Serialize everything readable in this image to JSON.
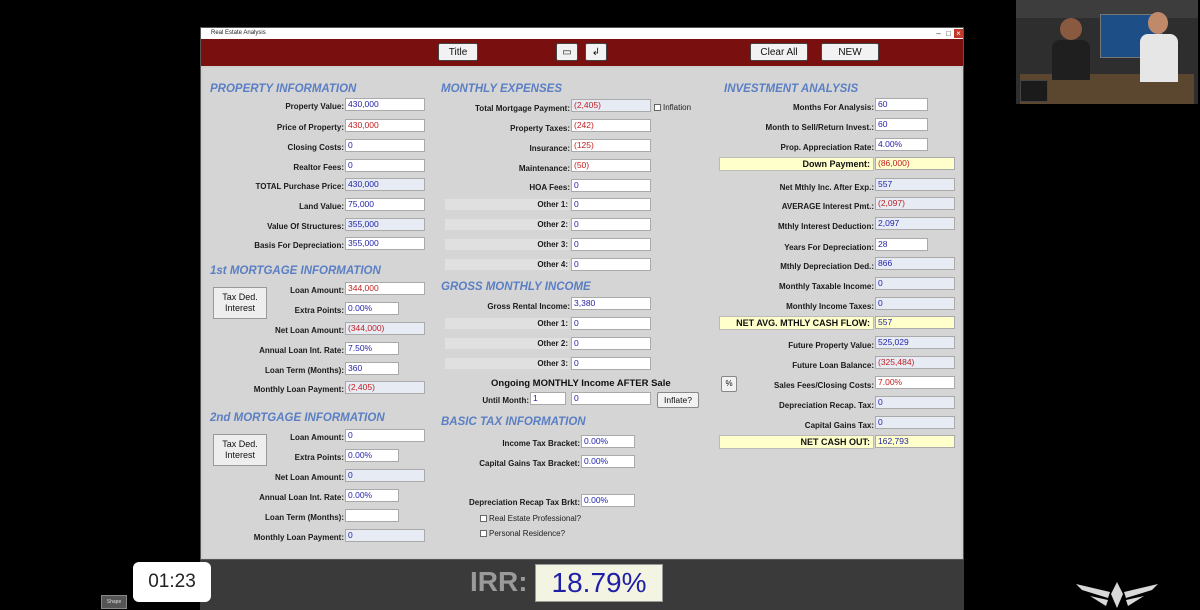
{
  "window": {
    "title": "Real Estate Analysis"
  },
  "toolbar": {
    "title_label": "Title",
    "clear_label": "Clear All",
    "new_label": "NEW"
  },
  "property": {
    "heading": "PROPERTY INFORMATION",
    "value_label": "Property Value:",
    "value": "430,000",
    "price_label": "Price of Property:",
    "price": "430,000",
    "closing_label": "Closing Costs:",
    "closing": "0",
    "realtor_label": "Realtor Fees:",
    "realtor": "0",
    "total_label": "TOTAL Purchase Price:",
    "total": "430,000",
    "land_label": "Land Value:",
    "land": "75,000",
    "structures_label": "Value Of Structures:",
    "structures": "355,000",
    "basis_label": "Basis For Depreciation:",
    "basis": "355,000"
  },
  "mortgage1": {
    "heading": "1st MORTGAGE INFORMATION",
    "tax_btn": "Tax Ded. Interest",
    "loan_label": "Loan Amount:",
    "loan": "344,000",
    "points_label": "Extra Points:",
    "points": "0.00%",
    "net_label": "Net Loan Amount:",
    "net": "(344,000)",
    "rate_label": "Annual Loan Int. Rate:",
    "rate": "7.50%",
    "term_label": "Loan Term (Months):",
    "term": "360",
    "payment_label": "Monthly Loan Payment:",
    "payment": "(2,405)"
  },
  "mortgage2": {
    "heading": "2nd MORTGAGE INFORMATION",
    "tax_btn": "Tax Ded. Interest",
    "loan_label": "Loan Amount:",
    "loan": "0",
    "points_label": "Extra Points:",
    "points": "0.00%",
    "net_label": "Net Loan Amount:",
    "net": "0",
    "rate_label": "Annual Loan Int. Rate:",
    "rate": "0.00%",
    "term_label": "Loan Term (Months):",
    "term": "",
    "payment_label": "Monthly Loan Payment:",
    "payment": "0"
  },
  "expenses": {
    "heading": "MONTHLY EXPENSES",
    "mortgage_label": "Total Mortgage Payment:",
    "mortgage": "(2,405)",
    "inflation_label": "Inflation",
    "taxes_label": "Property Taxes:",
    "taxes": "(242)",
    "insurance_label": "Insurance:",
    "insurance": "(125)",
    "maintenance_label": "Maintenance:",
    "maintenance": "(50)",
    "hoa_label": "HOA Fees:",
    "hoa": "0",
    "other1_label": "Other 1:",
    "other1": "0",
    "other2_label": "Other 2:",
    "other2": "0",
    "other3_label": "Other 3:",
    "other3": "0",
    "other4_label": "Other 4:",
    "other4": "0"
  },
  "income": {
    "heading": "GROSS MONTHLY INCOME",
    "rental_label": "Gross Rental Income:",
    "rental": "3,380",
    "other1_label": "Other 1:",
    "other1": "0",
    "other2_label": "Other 2:",
    "other2": "0",
    "other3_label": "Other 3:",
    "other3": "0",
    "ongoing_label": "Ongoing MONTHLY Income AFTER Sale",
    "until_label": "Until Month:",
    "until": "1",
    "ongoing_value": "0",
    "inflate_label": "Inflate?"
  },
  "tax": {
    "heading": "BASIC TAX INFORMATION",
    "income_label": "Income Tax Bracket:",
    "income": "0.00%",
    "capgains_label": "Capital Gains Tax Bracket:",
    "capgains": "0.00%",
    "recap_label": "Depreciation Recap Tax Brkt:",
    "recap": "0.00%",
    "professional_label": "Real Estate Professional?",
    "residence_label": "Personal Residence?"
  },
  "investment": {
    "heading": "INVESTMENT ANALYSIS",
    "months_label": "Months For Analysis:",
    "months": "60",
    "sell_label": "Month to Sell/Return Invest.:",
    "sell": "60",
    "appreciation_label": "Prop. Appreciation Rate:",
    "appreciation": "4.00%",
    "down_label": "Down Payment:",
    "down": "(86,000)",
    "netinc_label": "Net Mthly Inc. After Exp.:",
    "netinc": "557",
    "avgint_label": "AVERAGE Interest Pmt.:",
    "avgint": "(2,097)",
    "intded_label": "Mthly Interest Deduction:",
    "intded": "2,097",
    "years_label": "Years For Depreciation:",
    "years": "28",
    "depr_label": "Mthly Depreciation Ded.:",
    "depr": "866",
    "taxable_label": "Monthly Taxable Income:",
    "taxable": "0",
    "inctax_label": "Monthly Income Taxes:",
    "inctax": "0",
    "cashflow_label": "NET AVG. MTHLY CASH FLOW:",
    "cashflow": "557",
    "future_value_label": "Future Property Value:",
    "future_value": "525,029",
    "future_loan_label": "Future Loan Balance:",
    "future_loan": "(325,484)",
    "percent_btn": "%",
    "sales_fees_label": "Sales Fees/Closing Costs:",
    "sales_fees": "7.00%",
    "recap_tax_label": "Depreciation Recap. Tax:",
    "recap_tax": "0",
    "capgains_tax_label": "Capital Gains Tax:",
    "capgains_tax": "0",
    "cashout_label": "NET CASH OUT:",
    "cashout": "162,793"
  },
  "irr": {
    "label": "IRR:",
    "value": "18.79%"
  },
  "video": {
    "timestamp": "01:23",
    "shape_label": "Shape"
  }
}
